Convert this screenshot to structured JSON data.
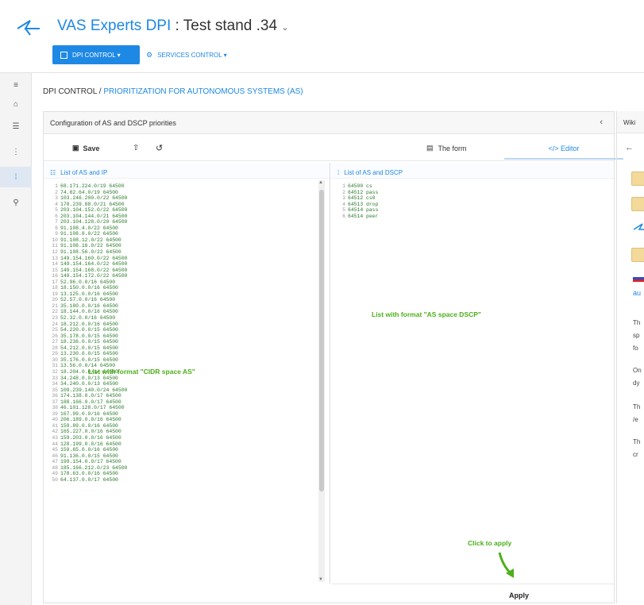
{
  "header": {
    "brand": "VAS Experts DPI",
    "separator": " : ",
    "stand": "Test stand .34",
    "stand_caret": "⌄",
    "nav": [
      {
        "label": "DPI CONTROL ▾"
      },
      {
        "label": "SERVICES CONTROL ▾"
      }
    ]
  },
  "breadcrumb": {
    "root": "DPI CONTROL",
    "sep": " / ",
    "current": "PRIORITIZATION FOR AUTONOMOUS SYSTEMS (AS)"
  },
  "panel": {
    "title": "Configuration of AS and DSCP priorities",
    "collapse": "‹",
    "save": "Save",
    "tab_form": "The form",
    "tab_editor": "</> Editor",
    "left_title": "List of AS and IP",
    "right_title": "List of AS and DSCP",
    "apply": "Apply",
    "annotations": {
      "left": "List with format \"CIDR space AS\"",
      "right": "List with format \"AS space DSCP\"",
      "apply": "Click to apply"
    }
  },
  "wiki": {
    "title": "Wiki",
    "back": "←",
    "text_frag": [
      "au",
      "Th",
      "sp",
      "fo",
      "On",
      "dy",
      "Th",
      "/e",
      "Th",
      "cr"
    ]
  },
  "as_ip_list": [
    "68.171.224.0/19 64500",
    "74.82.64.0/19 64500",
    "103.246.200.0/22 64500",
    "178.239.88.0/21 64500",
    "203.104.152.0/22 64500",
    "203.104.144.0/21 64500",
    "203.104.128.0/20 64500",
    "91.108.4.0/22 64500",
    "91.108.8.0/22 64500",
    "91.108.12.0/22 64500",
    "91.108.16.0/22 64500",
    "91.108.56.0/22 64500",
    "149.154.160.0/22 64500",
    "149.154.164.0/22 64500",
    "149.154.168.0/22 64500",
    "149.154.172.0/22 64500",
    "52.96.0.0/16 64500",
    "18.150.0.0/16 64500",
    "13.125.0.0/16 64500",
    "52.57.0.0/16 64500",
    "35.180.0.0/16 64500",
    "18.144.0.0/16 64500",
    "52.32.0.0/16 64500",
    "18.212.0.0/16 64500",
    "54.220.0.0/15 64500",
    "35.178.0.0/15 64500",
    "18.236.0.0/15 64500",
    "54.212.0.0/15 64500",
    "13.230.0.0/15 64500",
    "35.176.0.0/15 64500",
    "13.56.0.0/14 64500",
    "18.204.0.0/14 64500",
    "34.248.0.0/13 64500",
    "34.240.0.0/13 64500",
    "109.239.140.0/24 64500",
    "174.138.0.0/17 64500",
    "188.166.0.0/17 64500",
    "46.101.128.0/17 64500",
    "167.99.0.0/16 64500",
    "206.189.0.0/16 64500",
    "159.89.0.0/16 64500",
    "165.227.0.0/16 64500",
    "159.203.0.0/16 64500",
    "128.199.0.0/16 64500",
    "159.65.0.0/16 64500",
    "91.136.0.0/15 64500",
    "199.154.0.0/17 64500",
    "185.166.212.0/23 64500",
    "178.63.0.0/16 64500",
    "64.137.0.0/17 64500"
  ],
  "as_dscp_list": [
    "64500 cs",
    "64512 pass",
    "64512 cs0",
    "64513 drop",
    "64514 pass",
    "64514 peer"
  ],
  "colors": {
    "accent": "#1e88e5",
    "annotation": "#4caf1a",
    "code": "#2a7a2a"
  },
  "icons": [
    "logo-icon",
    "home-icon",
    "list-icon",
    "chart-icon",
    "priority-icon",
    "user-icon",
    "save-icon",
    "upload-icon",
    "history-icon",
    "form-icon",
    "code-icon",
    "arrow-left-icon"
  ]
}
